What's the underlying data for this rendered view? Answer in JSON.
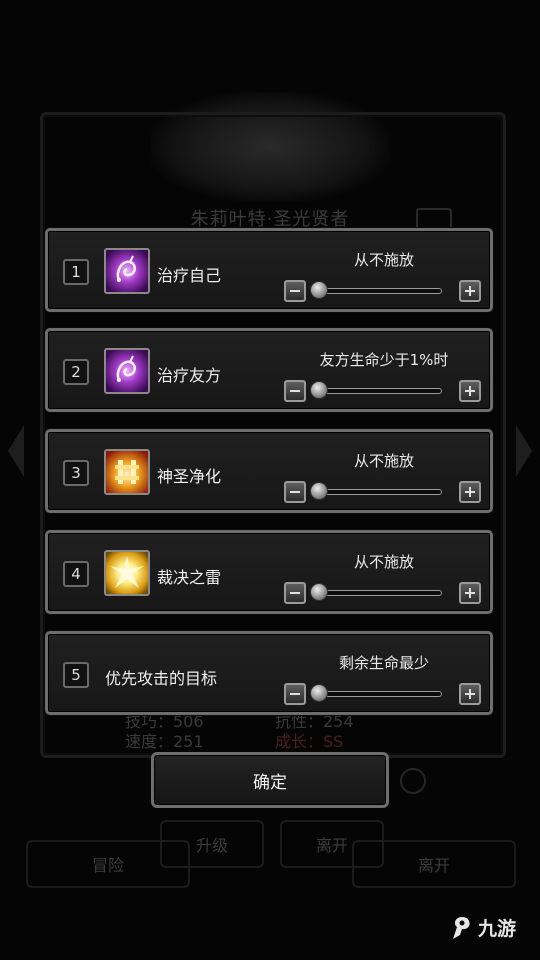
{
  "background": {
    "title": "朱莉叶特·圣光贤者",
    "stats": [
      {
        "left": "技巧：506",
        "right": "抗性：254"
      },
      {
        "left": "速度：251",
        "right": "成长：SS"
      }
    ],
    "buttons": {
      "upgrade": "升级",
      "leave": "离开",
      "adventure": "冒险",
      "leave2": "离开"
    }
  },
  "panels": [
    {
      "number": "1",
      "icon": "healing-swirl-icon",
      "name": "治疗自己",
      "condition": "从不施放",
      "slider_fraction": 0
    },
    {
      "number": "2",
      "icon": "healing-swirl-icon",
      "name": "治疗友方",
      "condition": "友方生命少于1%时",
      "slider_fraction": 0
    },
    {
      "number": "3",
      "icon": "holy-purify-icon",
      "name": "神圣净化",
      "condition": "从不施放",
      "slider_fraction": 0
    },
    {
      "number": "4",
      "icon": "thunder-judgement-icon",
      "name": "裁决之雷",
      "condition": "从不施放",
      "slider_fraction": 0
    },
    {
      "number": "5",
      "name": "优先攻击的目标",
      "condition": "剩余生命最少",
      "slider_fraction": 0
    }
  ],
  "confirm_label": "确定",
  "watermark": "九游",
  "colors": {
    "panel_border": "#6d6d6d",
    "panel_bg": "#1c1c1c",
    "text": "#f0f0f0",
    "background": "#050505"
  }
}
